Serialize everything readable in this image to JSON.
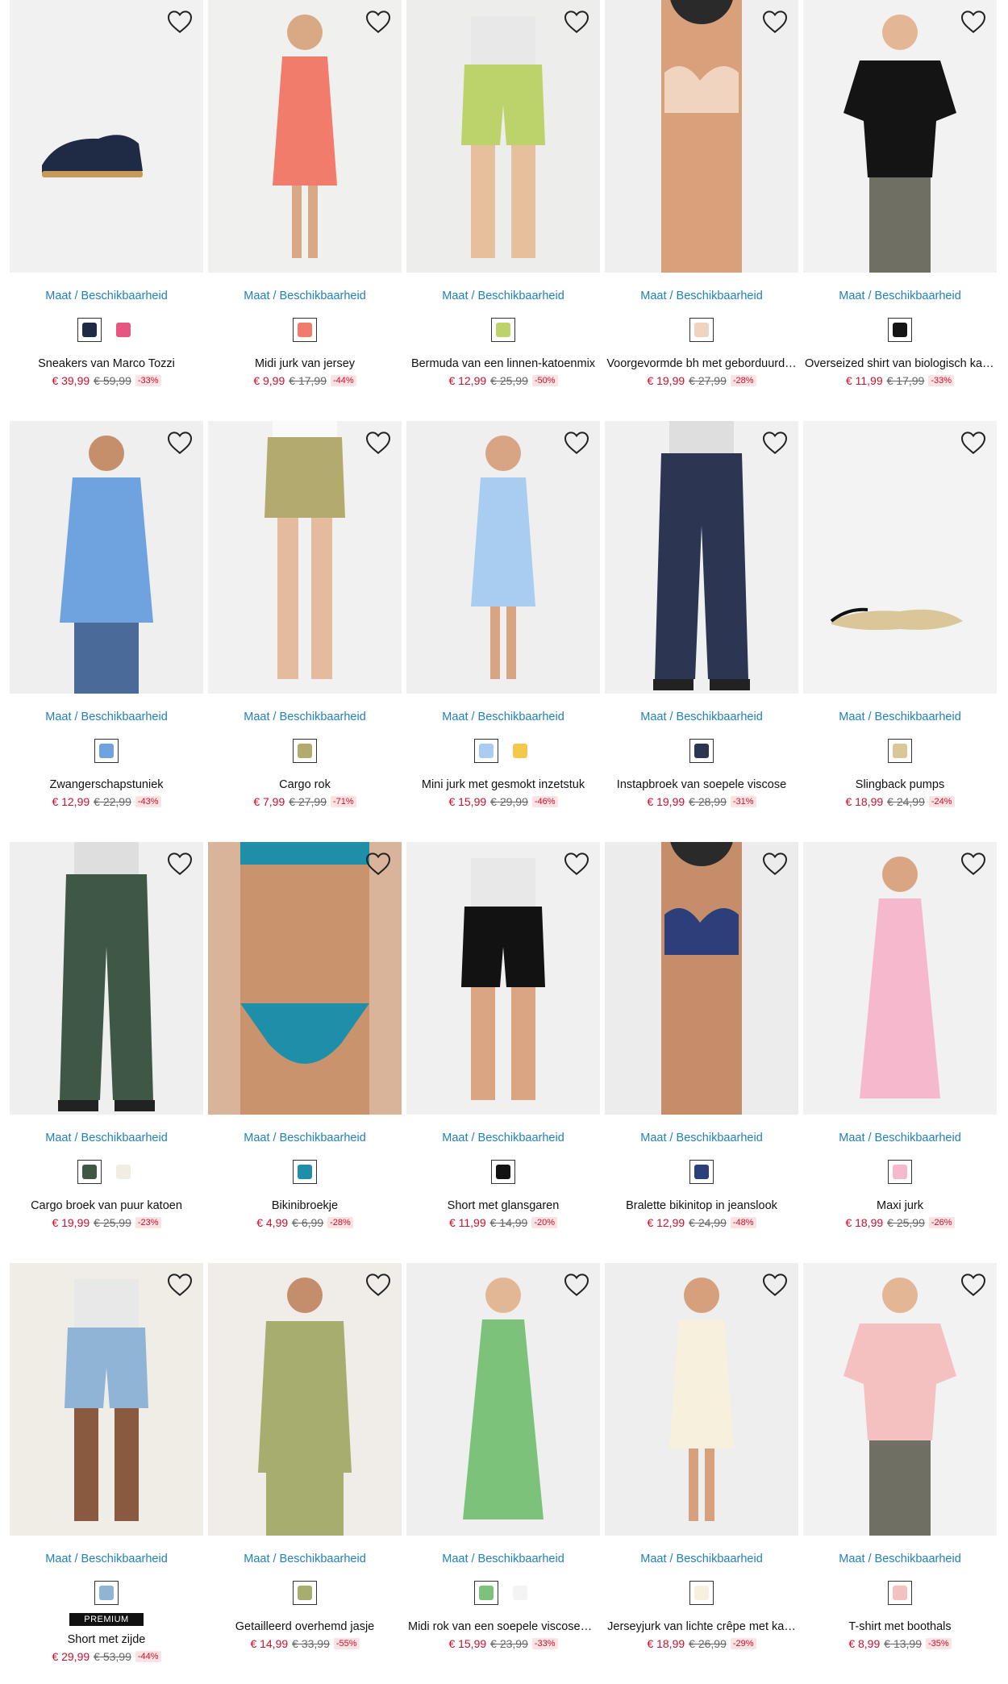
{
  "size_label": "Maat / Beschikbaarheid",
  "products": [
    {
      "name": "Sneakers van Marco Tozzi",
      "price": "€ 39,99",
      "old_price": "€ 59,99",
      "discount": "-33%",
      "bg": "#f1f1f1",
      "garment": "shoe",
      "garment_color": "#1f2a44",
      "skin": "#e8c2a0",
      "swatches": [
        "#1f2a44",
        "#e6567e"
      ]
    },
    {
      "name": "Midi jurk van jersey",
      "price": "€ 9,99",
      "old_price": "€ 17,99",
      "discount": "-44%",
      "bg": "#f0f0ee",
      "garment": "dress",
      "garment_color": "#f27c6b",
      "skin": "#d9a884",
      "swatches": [
        "#f27c6b"
      ]
    },
    {
      "name": "Bermuda van een linnen-katoenmix",
      "price": "€ 12,99",
      "old_price": "€ 25,99",
      "discount": "-50%",
      "bg": "#ededeb",
      "garment": "shorts",
      "garment_color": "#bcd26a",
      "skin": "#e6bf9d",
      "swatches": [
        "#bcd26a"
      ]
    },
    {
      "name": "Voorgevormde bh met geborduurd…",
      "price": "€ 19,99",
      "old_price": "€ 27,99",
      "discount": "-28%",
      "bg": "#efefef",
      "garment": "bra",
      "garment_color": "#f1d4c0",
      "skin": "#d9a07c",
      "swatches": [
        "#f1d4c0"
      ]
    },
    {
      "name": "Overseized shirt van biologisch kat…",
      "price": "€ 11,99",
      "old_price": "€ 17,99",
      "discount": "-33%",
      "bg": "#f2f2f2",
      "garment": "shirt",
      "garment_color": "#141414",
      "skin": "#e3b795",
      "swatches": [
        "#141414"
      ]
    },
    {
      "name": "Zwangerschapstuniek",
      "price": "€ 12,99",
      "old_price": "€ 22,99",
      "discount": "-43%",
      "bg": "#efefef",
      "garment": "tunic",
      "garment_color": "#6ea3e0",
      "skin": "#c58f6c",
      "swatches": [
        "#6ea3e0"
      ]
    },
    {
      "name": "Cargo rok",
      "price": "€ 7,99",
      "old_price": "€ 27,99",
      "discount": "-71%",
      "bg": "#f1f1f1",
      "garment": "skirt",
      "garment_color": "#b3ab6e",
      "skin": "#e4bb9c",
      "swatches": [
        "#b3ab6e"
      ]
    },
    {
      "name": "Mini jurk met gesmokt inzetstuk",
      "price": "€ 15,99",
      "old_price": "€ 29,99",
      "discount": "-46%",
      "bg": "#efefef",
      "garment": "dress",
      "garment_color": "#a8cdf0",
      "skin": "#d7a583",
      "swatches": [
        "#a8cdf0",
        "#f2c94c"
      ]
    },
    {
      "name": "Instapbroek van soepele viscose",
      "price": "€ 19,99",
      "old_price": "€ 28,99",
      "discount": "-31%",
      "bg": "#f0f0f0",
      "garment": "trousers",
      "garment_color": "#2c3552",
      "skin": "#e6c1a4",
      "swatches": [
        "#2c3552"
      ]
    },
    {
      "name": "Slingback pumps",
      "price": "€ 18,99",
      "old_price": "€ 24,99",
      "discount": "-24%",
      "bg": "#f3f3f3",
      "garment": "pump",
      "garment_color": "#d9c79a",
      "skin": "#e6c1a4",
      "swatches": [
        "#d9c79a"
      ]
    },
    {
      "name": "Cargo broek van puur katoen",
      "price": "€ 19,99",
      "old_price": "€ 25,99",
      "discount": "-23%",
      "bg": "#efefef",
      "garment": "trousers",
      "garment_color": "#3f5846",
      "skin": "#e3b99a",
      "swatches": [
        "#3f5846",
        "#f1ede2"
      ]
    },
    {
      "name": "Bikinibroekje",
      "price": "€ 4,99",
      "old_price": "€ 6,99",
      "discount": "-28%",
      "bg": "#d9b49a",
      "garment": "bikini",
      "garment_color": "#1e8fa8",
      "skin": "#c9936d",
      "swatches": [
        "#1e8fa8"
      ]
    },
    {
      "name": "Short met glansgaren",
      "price": "€ 11,99",
      "old_price": "€ 14,99",
      "discount": "-20%",
      "bg": "#f0f0f0",
      "garment": "shorts",
      "garment_color": "#121212",
      "skin": "#d9a582",
      "swatches": [
        "#121212"
      ]
    },
    {
      "name": "Bralette bikinitop in jeanslook",
      "price": "€ 12,99",
      "old_price": "€ 24,99",
      "discount": "-48%",
      "bg": "#ececec",
      "garment": "bra",
      "garment_color": "#2d3f7a",
      "skin": "#c58d6a",
      "swatches": [
        "#2d3f7a"
      ]
    },
    {
      "name": "Maxi jurk",
      "price": "€ 18,99",
      "old_price": "€ 25,99",
      "discount": "-26%",
      "bg": "#f1f1f1",
      "garment": "longdress",
      "garment_color": "#f5b8cd",
      "skin": "#d9a583",
      "swatches": [
        "#f5b8cd"
      ]
    },
    {
      "name": "Short met zijde",
      "price": "€ 29,99",
      "old_price": "€ 53,99",
      "discount": "-44%",
      "premium": "PREMIUM",
      "bg": "#f0ece6",
      "garment": "shorts",
      "garment_color": "#8fb4d6",
      "skin": "#8a5a40",
      "swatches": [
        "#8fb4d6"
      ]
    },
    {
      "name": "Getailleerd overhemd jasje",
      "price": "€ 14,99",
      "old_price": "€ 33,99",
      "discount": "-55%",
      "bg": "#f0ede8",
      "garment": "jacket",
      "garment_color": "#a7ad6e",
      "skin": "#c48d6b",
      "swatches": [
        "#a7ad6e"
      ]
    },
    {
      "name": "Midi rok van een soepele viscosemix",
      "price": "€ 15,99",
      "old_price": "€ 23,99",
      "discount": "-33%",
      "bg": "#efefef",
      "garment": "longdress",
      "garment_color": "#7cc27a",
      "skin": "#e2b796",
      "swatches": [
        "#7cc27a",
        "#f4f4f4"
      ]
    },
    {
      "name": "Jerseyjurk van lichte crêpe met ka…",
      "price": "€ 18,99",
      "old_price": "€ 26,99",
      "discount": "-29%",
      "bg": "#eeeeee",
      "garment": "dress",
      "garment_color": "#f7f0dc",
      "skin": "#d6a07c",
      "swatches": [
        "#f7f0dc"
      ]
    },
    {
      "name": "T-shirt met boothals",
      "price": "€ 8,99",
      "old_price": "€ 13,99",
      "discount": "-35%",
      "bg": "#f2f2f2",
      "garment": "shirt",
      "garment_color": "#f5c0c0",
      "skin": "#e3b795",
      "swatches": [
        "#f5c0c0"
      ]
    }
  ]
}
